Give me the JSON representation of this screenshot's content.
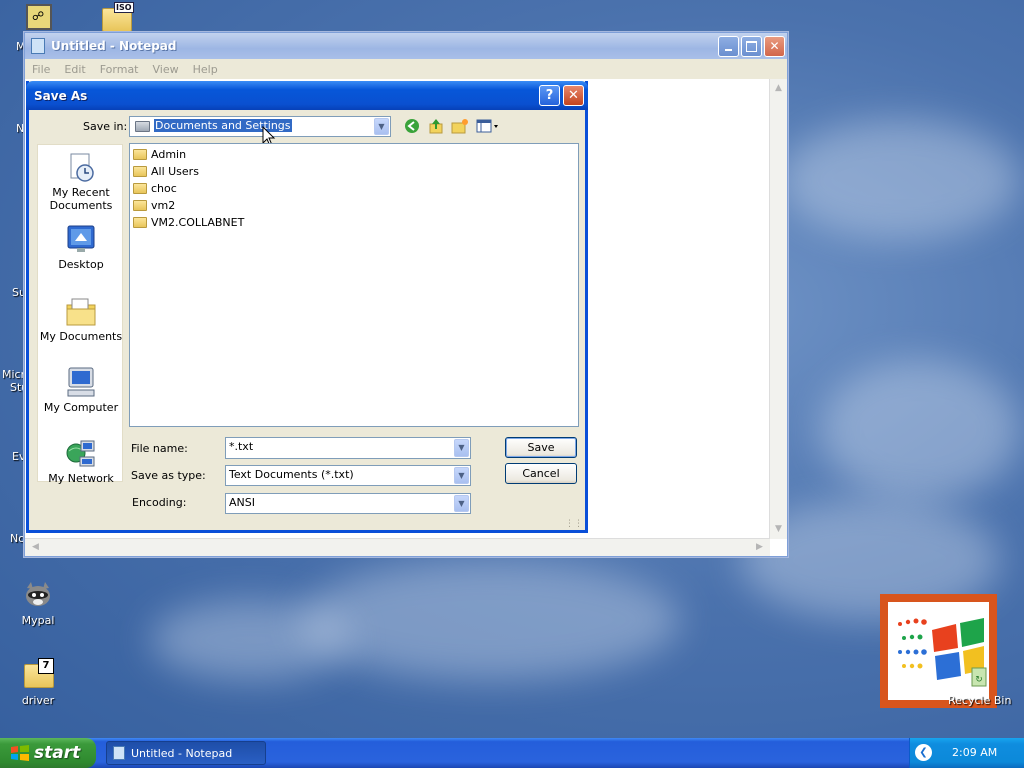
{
  "desktop": {
    "icons": [
      {
        "label": "Mypal",
        "icon": "raccoon-icon"
      },
      {
        "label": "driver",
        "icon": "zip-folder-icon",
        "badge": "7"
      },
      {
        "label": "Recycle Bin",
        "icon": "recycle-bin-icon"
      }
    ],
    "top_icon_badge": "ISO",
    "edge_labels": [
      "M",
      "N",
      "Su",
      "Micro",
      "Stu",
      "Ev",
      "No"
    ]
  },
  "notepad": {
    "title": "Untitled - Notepad",
    "menu": [
      "File",
      "Edit",
      "Format",
      "View",
      "Help"
    ]
  },
  "save_as": {
    "title": "Save As",
    "save_in_label": "Save in:",
    "save_in_value": "Documents and Settings",
    "places": [
      {
        "label": "My Recent Documents",
        "icon": "recent-documents-icon"
      },
      {
        "label": "Desktop",
        "icon": "desktop-icon"
      },
      {
        "label": "My Documents",
        "icon": "my-documents-icon"
      },
      {
        "label": "My Computer",
        "icon": "my-computer-icon"
      },
      {
        "label": "My Network",
        "icon": "my-network-icon"
      }
    ],
    "files": [
      "Admin",
      "All Users",
      "choc",
      "vm2",
      "VM2.COLLABNET"
    ],
    "file_name_label": "File name:",
    "file_name_value": "*.txt",
    "save_as_type_label": "Save as type:",
    "save_as_type_value": "Text Documents (*.txt)",
    "encoding_label": "Encoding:",
    "encoding_value": "ANSI",
    "save_button": "Save",
    "cancel_button": "Cancel"
  },
  "taskbar": {
    "start_label": "start",
    "task_label": "Untitled - Notepad",
    "clock": "2:09 AM"
  }
}
